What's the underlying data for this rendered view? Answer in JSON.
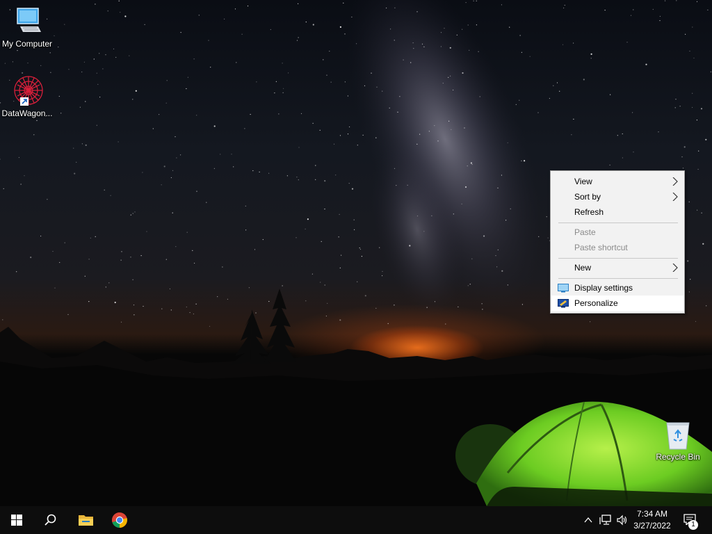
{
  "desktop": {
    "icons": [
      {
        "label": "My Computer",
        "icon": "computer-icon"
      },
      {
        "label": "DataWagon...",
        "icon": "datawagon-shortcut-icon"
      },
      {
        "label": "Recycle Bin",
        "icon": "recycle-bin-icon"
      }
    ]
  },
  "context_menu": {
    "items": [
      {
        "label": "View",
        "has_submenu": true,
        "enabled": true
      },
      {
        "label": "Sort by",
        "has_submenu": true,
        "enabled": true
      },
      {
        "label": "Refresh",
        "has_submenu": false,
        "enabled": true
      },
      {
        "label": "Paste",
        "has_submenu": false,
        "enabled": false
      },
      {
        "label": "Paste shortcut",
        "has_submenu": false,
        "enabled": false
      },
      {
        "label": "New",
        "has_submenu": true,
        "enabled": true
      },
      {
        "label": "Display settings",
        "has_submenu": false,
        "enabled": true,
        "icon": "display-settings-icon"
      },
      {
        "label": "Personalize",
        "has_submenu": false,
        "enabled": true,
        "icon": "personalize-icon",
        "highlighted": true
      }
    ]
  },
  "taskbar": {
    "buttons": [
      {
        "name": "start",
        "icon": "windows-logo-icon"
      },
      {
        "name": "search",
        "icon": "search-icon"
      },
      {
        "name": "file-explorer",
        "icon": "folder-icon"
      },
      {
        "name": "chrome",
        "icon": "chrome-icon"
      }
    ],
    "tray": {
      "icons": [
        "chevron-up-icon",
        "network-icon",
        "volume-icon"
      ],
      "time": "7:34 AM",
      "date": "3/27/2022",
      "notification_count": "1"
    }
  },
  "colors": {
    "taskbar": "#0d0d0d",
    "menu_background": "#f2f2f2",
    "menu_highlight": "#ffffff",
    "disabled_text": "#8a8a8a",
    "tent_green": "#7cd629"
  }
}
